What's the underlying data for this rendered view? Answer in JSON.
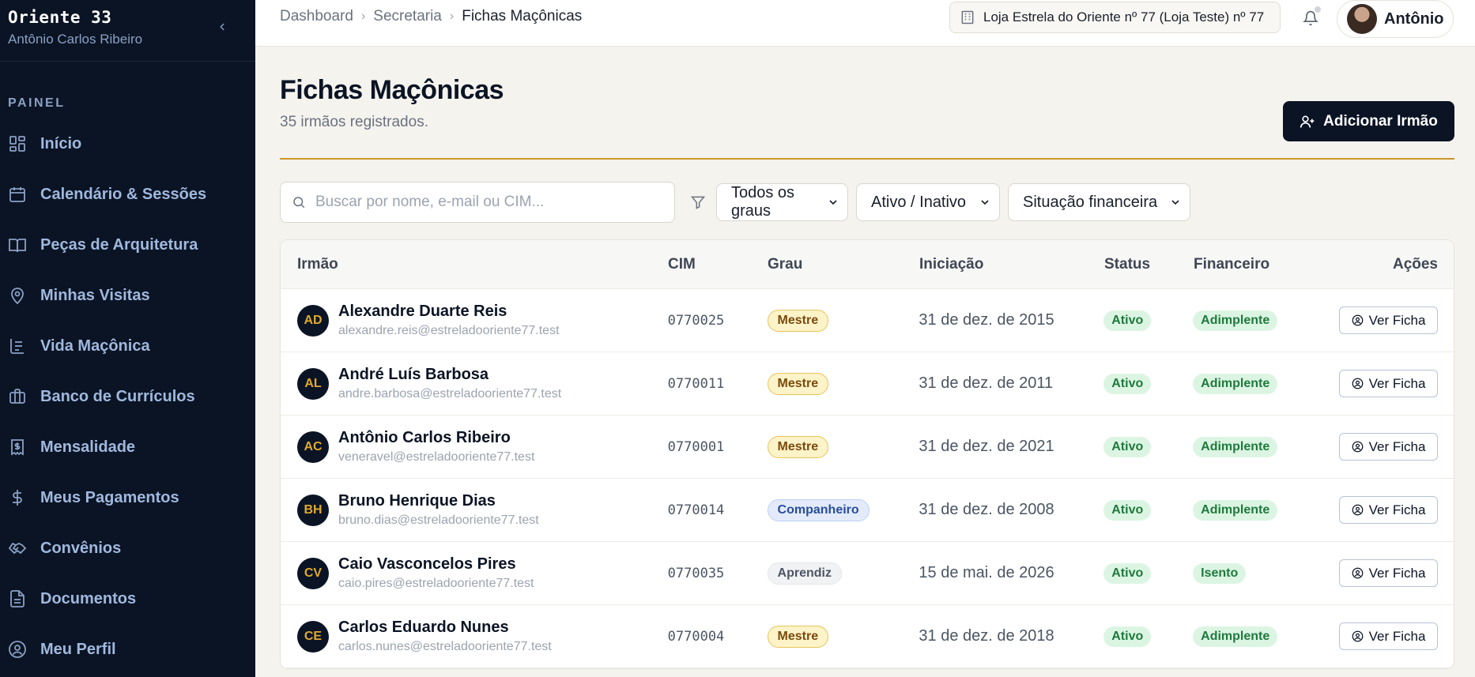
{
  "sidebar": {
    "brand_title": "Oriente 33",
    "brand_subtitle": "Antônio Carlos Ribeiro",
    "section_label": "PAINEL",
    "items": [
      {
        "label": "Início",
        "icon": "grid-icon"
      },
      {
        "label": "Calendário & Sessões",
        "icon": "calendar-icon"
      },
      {
        "label": "Peças de Arquitetura",
        "icon": "book-icon"
      },
      {
        "label": "Minhas Visitas",
        "icon": "map-pin-icon"
      },
      {
        "label": "Vida Maçônica",
        "icon": "timeline-icon"
      },
      {
        "label": "Banco de Currículos",
        "icon": "briefcase-icon"
      },
      {
        "label": "Mensalidade",
        "icon": "receipt-icon"
      },
      {
        "label": "Meus Pagamentos",
        "icon": "dollar-icon"
      },
      {
        "label": "Convênios",
        "icon": "handshake-icon"
      },
      {
        "label": "Documentos",
        "icon": "document-icon"
      },
      {
        "label": "Meu Perfil",
        "icon": "user-circle-icon"
      }
    ]
  },
  "topbar": {
    "breadcrumb": [
      "Dashboard",
      "Secretaria",
      "Fichas Maçônicas"
    ],
    "lodge": "Loja Estrela do Oriente nº 77 (Loja Teste) nº 77",
    "user_name": "Antônio"
  },
  "main": {
    "title": "Fichas Maçônicas",
    "subtitle": "35 irmãos registrados.",
    "add_button": "Adicionar Irmão",
    "search_placeholder": "Buscar por nome, e-mail ou CIM...",
    "filters": [
      "Todos os graus",
      "Ativo / Inativo",
      "Situação financeira"
    ]
  },
  "table": {
    "headers": [
      "Irmão",
      "CIM",
      "Grau",
      "Iniciação",
      "Status",
      "Financeiro",
      "Ações"
    ],
    "action_label": "Ver Ficha",
    "rows": [
      {
        "initials": "AD",
        "name": "Alexandre Duarte Reis",
        "email": "alexandre.reis@estreladooriente77.test",
        "cim": "0770025",
        "grau": "Mestre",
        "iniciacao": "31 de dez. de 2015",
        "status": "Ativo",
        "financeiro": "Adimplente"
      },
      {
        "initials": "AL",
        "name": "André Luís Barbosa",
        "email": "andre.barbosa@estreladooriente77.test",
        "cim": "0770011",
        "grau": "Mestre",
        "iniciacao": "31 de dez. de 2011",
        "status": "Ativo",
        "financeiro": "Adimplente"
      },
      {
        "initials": "AC",
        "name": "Antônio Carlos Ribeiro",
        "email": "veneravel@estreladooriente77.test",
        "cim": "0770001",
        "grau": "Mestre",
        "iniciacao": "31 de dez. de 2021",
        "status": "Ativo",
        "financeiro": "Adimplente"
      },
      {
        "initials": "BH",
        "name": "Bruno Henrique Dias",
        "email": "bruno.dias@estreladooriente77.test",
        "cim": "0770014",
        "grau": "Companheiro",
        "iniciacao": "31 de dez. de 2008",
        "status": "Ativo",
        "financeiro": "Adimplente"
      },
      {
        "initials": "CV",
        "name": "Caio Vasconcelos Pires",
        "email": "caio.pires@estreladooriente77.test",
        "cim": "0770035",
        "grau": "Aprendiz",
        "iniciacao": "15 de mai. de 2026",
        "status": "Ativo",
        "financeiro": "Isento"
      },
      {
        "initials": "CE",
        "name": "Carlos Eduardo Nunes",
        "email": "carlos.nunes@estreladooriente77.test",
        "cim": "0770004",
        "grau": "Mestre",
        "iniciacao": "31 de dez. de 2018",
        "status": "Ativo",
        "financeiro": "Adimplente"
      }
    ]
  },
  "colors": {
    "sidebar_bg": "#0b1424",
    "accent_gold": "#c9962b",
    "nav_text": "#9fb8de"
  }
}
